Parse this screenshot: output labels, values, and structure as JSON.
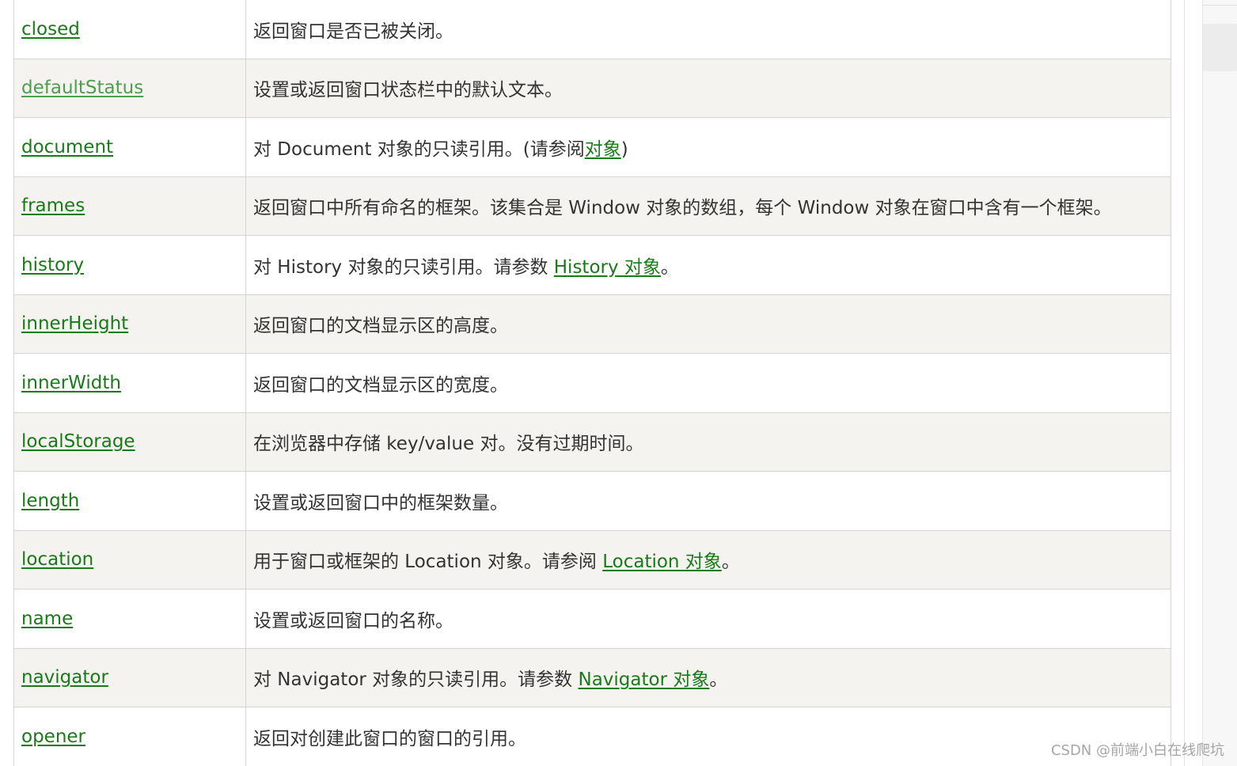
{
  "rows": [
    {
      "name": "closed",
      "desc": [
        {
          "t": "返回窗口是否已被关闭。"
        }
      ]
    },
    {
      "name": "defaultStatus",
      "desc": [
        {
          "t": "设置或返回窗口状态栏中的默认文本。"
        }
      ]
    },
    {
      "name": "document",
      "desc": [
        {
          "t": "对 Document 对象的只读引用。(请参阅"
        },
        {
          "t": "对象",
          "link": true
        },
        {
          "t": ")"
        }
      ]
    },
    {
      "name": "frames",
      "desc": [
        {
          "t": "返回窗口中所有命名的框架。该集合是 Window 对象的数组，每个 Window 对象在窗口中含有一个框架。"
        }
      ]
    },
    {
      "name": "history",
      "desc": [
        {
          "t": "对 History 对象的只读引用。请参数 "
        },
        {
          "t": "History 对象",
          "link": true
        },
        {
          "t": "。"
        }
      ]
    },
    {
      "name": "innerHeight",
      "desc": [
        {
          "t": "返回窗口的文档显示区的高度。"
        }
      ]
    },
    {
      "name": "innerWidth",
      "desc": [
        {
          "t": "返回窗口的文档显示区的宽度。"
        }
      ]
    },
    {
      "name": "localStorage",
      "desc": [
        {
          "t": "在浏览器中存储 key/value 对。没有过期时间。"
        }
      ]
    },
    {
      "name": "length",
      "desc": [
        {
          "t": "设置或返回窗口中的框架数量。"
        }
      ]
    },
    {
      "name": "location",
      "desc": [
        {
          "t": "用于窗口或框架的 Location 对象。请参阅 "
        },
        {
          "t": "Location 对象",
          "link": true
        },
        {
          "t": "。"
        }
      ]
    },
    {
      "name": "name",
      "desc": [
        {
          "t": "设置或返回窗口的名称。"
        }
      ]
    },
    {
      "name": "navigator",
      "desc": [
        {
          "t": "对 Navigator 对象的只读引用。请参数 "
        },
        {
          "t": "Navigator 对象",
          "link": true
        },
        {
          "t": "。"
        }
      ]
    },
    {
      "name": "opener",
      "desc": [
        {
          "t": "返回对创建此窗口的窗口的引用。"
        }
      ]
    }
  ],
  "watermark": "CSDN @前端小白在线爬坑",
  "colors": {
    "link": "#1a7a1a",
    "row_alt": "#f4f3ef",
    "border": "#d4d4d4",
    "text": "#333333"
  }
}
